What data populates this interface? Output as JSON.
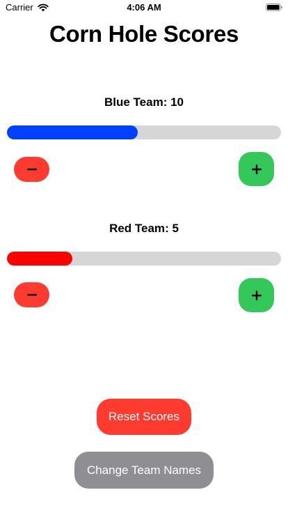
{
  "status_bar": {
    "carrier": "Carrier",
    "time": "4:06 AM",
    "icons": [
      "wifi-icon",
      "battery-icon"
    ]
  },
  "title": "Corn Hole Scores",
  "teams": [
    {
      "name": "Blue Team",
      "score": "10",
      "progress_fraction": 0.476,
      "color": "#0040ff",
      "minus_icon": "minus-icon",
      "plus_icon": "plus-icon"
    },
    {
      "name": "Red Team",
      "score": "5",
      "progress_fraction": 0.238,
      "color": "#ff0000",
      "minus_icon": "minus-icon",
      "plus_icon": "plus-icon"
    }
  ],
  "buttons": {
    "reset": "Reset Scores",
    "change_names": "Change Team Names"
  },
  "colors": {
    "minus_button": "#ff3b30",
    "plus_button": "#34c759",
    "reset_button": "#ff3b30",
    "names_button": "#8e8e93",
    "track": "#d6d6d6"
  }
}
